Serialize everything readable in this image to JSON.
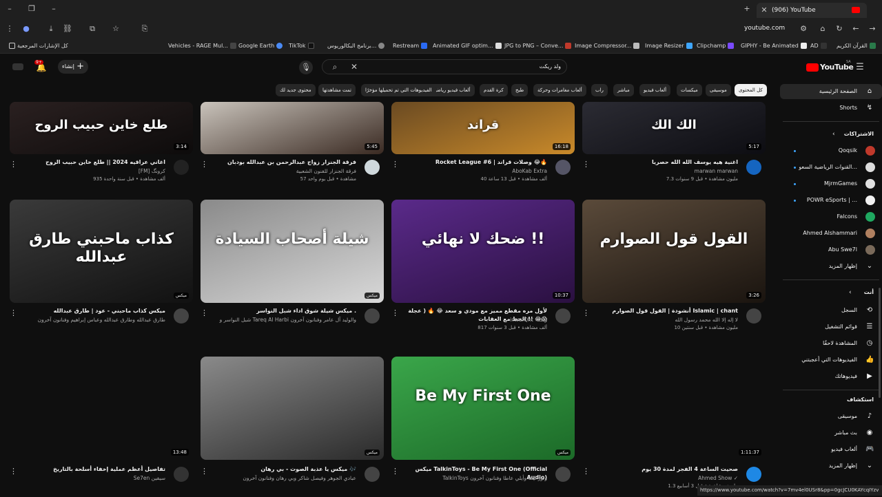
{
  "browser": {
    "tab_title": "(906) YouTube",
    "url": "youtube.com",
    "bookmarks": [
      "كل الإشارات المرجعية",
      "Vehicles - RAGE Mul...",
      "Google Earth",
      "TikTok",
      "برنامج البكالوريوس...",
      "Restream",
      "Animated GIF optim...",
      "JPG to PNG – Conve...",
      "Image Compressor...",
      "Image Resizer",
      "Clipchamp",
      "GIPHY - Be Animated",
      "AD",
      "القرآن الكريم"
    ],
    "status_url": "https://www.youtube.com/watch?v=7mv4el0USr8&pp=0gcJCU0KAYcqIYzv"
  },
  "yt": {
    "logo": "YouTube",
    "country": "SA",
    "search_value": "ولد ريكت",
    "create_label": "إنشاء",
    "notif_count": "9+",
    "chips": [
      "كل المحتوى",
      "موسيقى",
      "ميكسات",
      "ألعاب فيديو",
      "مباشر",
      "راب",
      "ألعاب مغامرات وحركة",
      "طبخ",
      "كرة القدم",
      "ألعاب فيديو رياضية",
      "الفيديوهات التي تم تحميلها مؤخرًا",
      "تمت مشاهدتها",
      "محتوى جديد لك"
    ]
  },
  "videos": [
    {
      "title": "اغنية هيه يوسف الله الله حصريا",
      "channel": "marwan marwan",
      "meta": "7.3 مليون مشاهدة • قبل 9 سنوات",
      "dur": "5:17",
      "thumb_text": "الك الك",
      "colors": [
        "#2b2b33",
        "#0d0d12"
      ]
    },
    {
      "title": "Rocket League #6 | وصلات قراند 😂🔥",
      "channel": "AboKab Extra",
      "meta": "40 ألف مشاهدة • قبل 13 ساعة",
      "dur": "16:18",
      "thumb_text": "قراند",
      "colors": [
        "#6a4a22",
        "#c98a2a"
      ]
    },
    {
      "title": "فرقة الجنزار زواج عبدالرحمن بن عبدالله بودبان",
      "channel": "فرقة الجنزار للفنون الشعبية",
      "meta": "57 مشاهدة • قبل يوم واحد",
      "dur": "5:45",
      "thumb_text": "",
      "colors": [
        "#c9c3bb",
        "#3a2a22"
      ]
    },
    {
      "title": "اغاني عراقيه 2024 || طلع خاين حبيب الروح",
      "channel": "[FM] كرونگ",
      "meta": "935 ألف مشاهدة • قبل سنة واحدة",
      "dur": "3:14",
      "thumb_text": "طلع خاين حبيب الروح",
      "colors": [
        "#2a2020",
        "#0d0b0b"
      ]
    },
    {
      "title": "أنشودة | القول قول الصوارم Islamic | chant",
      "channel": "لا إله إلا الله محمد رسول الله",
      "meta": "10 مليون مشاهدة • قبل سنتين",
      "dur": "3:26",
      "thumb_text": "القول قول الصوارم",
      "colors": [
        "#5a4a3a",
        "#1a140f"
      ]
    },
    {
      "title": "لأول مره مقطع مميز مع مودي و سعد 😂 🔥 ( عجلة الحظ مع العقابات !! 😂😱",
      "channel": "inwafQht ✓رافـ",
      "meta": "817 ألف مشاهدة • قبل 3 سنوات",
      "dur": "10:37",
      "thumb_text": "ضحك لا نهائي !!",
      "colors": [
        "#5a2a8a",
        "#2a1040"
      ]
    },
    {
      "title": "ميكس شيلة شوق اداء شبل النواسر .",
      "channel": "شبل النواسر و Tareq Al Harbi والوليد آل عامر وفنانون آخرون",
      "meta": "",
      "dur": "ميكس",
      "thumb_text": "شيلة أصحاب السيادة",
      "colors": [
        "#8a8a8a",
        "#d8d8d8"
      ]
    },
    {
      "title": "ميكس كذاب ماحبني - عود | طارق عبدالله",
      "channel": "طارق عبدالله وطارق عبدالله وعباس إبراهيم وفنانون آخرون",
      "meta": "",
      "dur": "ميكس",
      "thumb_text": "كذاب ماحبني طارق عبدالله",
      "colors": [
        "#3a3a3a",
        "#111111"
      ]
    },
    {
      "title": "صحيت الساعة 4 الفجر لمدة 30 يوم",
      "channel": "Ahmed Show ✓",
      "meta": "1.3 مليون مشاهدة • قبل 3 أسابيع",
      "dur": "1:11:37",
      "thumb_text": "",
      "colors": [
        "#0f0f0f",
        "#0f0f0f"
      ]
    },
    {
      "title": "ميكس TalkinToys - Be My First One (Official Audio)",
      "channel": "TalkinToys ونور ليث وأيلي عاطا وفنانون آخرون",
      "meta": "",
      "dur": "ميكس",
      "thumb_text": "Be My First One",
      "colors": [
        "#3aa64a",
        "#1c6a28"
      ]
    },
    {
      "title": "ميكس يا عذبة الصوت - بي رهان 🎶",
      "channel": "عبادي الجوهر وفيصل شاكر وبي رهان وفنانون آخرون",
      "meta": "",
      "dur": "ميكس",
      "thumb_text": "",
      "colors": [
        "#8a8a8a",
        "#2a2a2a"
      ]
    },
    {
      "title": "تفاصيل أعظم عملية إخفاء أسلحة بالتاريخ",
      "channel": "Se7en سيفين",
      "meta": "",
      "dur": "13:48",
      "thumb_text": "",
      "colors": [
        "#0f0f0f",
        "#0f0f0f"
      ]
    }
  ],
  "sidebar": {
    "home": "الصفحة الرئيسية",
    "shorts": "Shorts",
    "subs_header": "الاشتراكات",
    "subs": [
      {
        "name": "Qoqsik",
        "color": "#c0392b"
      },
      {
        "name": "القنوات الرياضية السعو...",
        "color": "#dcdcdc"
      },
      {
        "name": "MjrmGames",
        "color": "#e0e0e0"
      },
      {
        "name": "POWR eSports | ...",
        "color": "#f1f1f1"
      },
      {
        "name": "Falcons",
        "color": "#1fa860"
      },
      {
        "name": "Ahmed Alshammari",
        "color": "#b08060"
      },
      {
        "name": "Abu Swe7l",
        "color": "#7a6a5a"
      }
    ],
    "show_more": "إظهار المزيد",
    "you_header": "أنت",
    "you_items": [
      "السجل",
      "قوائم التشغيل",
      "المشاهدة لاحقًا",
      "الفيديوهات التي أعجبتني",
      "فيديوهاتك"
    ],
    "explore_header": "استكشاف",
    "explore_items": [
      "موسيقى",
      "بث مباشر",
      "ألعاب فيديو",
      "إظهار المزيد"
    ]
  }
}
